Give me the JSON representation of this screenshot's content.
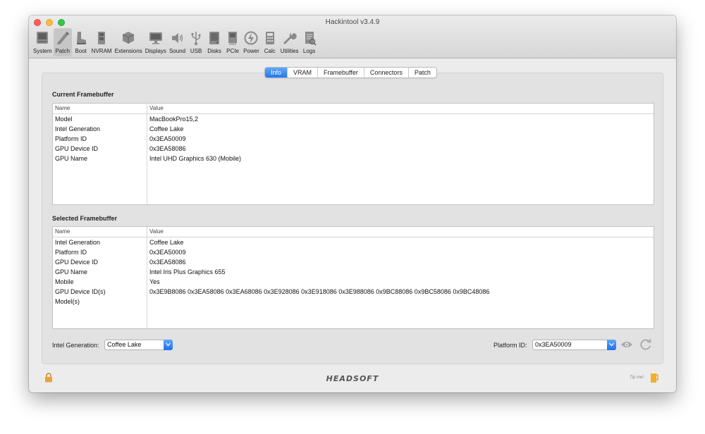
{
  "window": {
    "title": "Hackintool v3.4.9"
  },
  "toolbar": {
    "items": [
      {
        "label": "System",
        "icon": "system-icon"
      },
      {
        "label": "Patch",
        "icon": "patch-icon",
        "active": true
      },
      {
        "label": "Boot",
        "icon": "boot-icon"
      },
      {
        "label": "NVRAM",
        "icon": "nvram-icon"
      },
      {
        "label": "Extensions",
        "icon": "extensions-icon"
      },
      {
        "label": "Displays",
        "icon": "displays-icon"
      },
      {
        "label": "Sound",
        "icon": "sound-icon"
      },
      {
        "label": "USB",
        "icon": "usb-icon"
      },
      {
        "label": "Disks",
        "icon": "disks-icon"
      },
      {
        "label": "PCIe",
        "icon": "pcie-icon"
      },
      {
        "label": "Power",
        "icon": "power-icon"
      },
      {
        "label": "Calc",
        "icon": "calc-icon"
      },
      {
        "label": "Utilities",
        "icon": "utilities-icon"
      },
      {
        "label": "Logs",
        "icon": "logs-icon"
      }
    ]
  },
  "tabs": [
    {
      "label": "Info",
      "active": true
    },
    {
      "label": "VRAM"
    },
    {
      "label": "Framebuffer"
    },
    {
      "label": "Connectors"
    },
    {
      "label": "Patch"
    }
  ],
  "current_framebuffer": {
    "title": "Current Framebuffer",
    "columns": [
      "Name",
      "Value"
    ],
    "rows": [
      [
        "Model",
        "MacBookPro15,2"
      ],
      [
        "Intel Generation",
        "Coffee Lake"
      ],
      [
        "Platform ID",
        "0x3EA50009"
      ],
      [
        "GPU Device ID",
        "0x3EA58086"
      ],
      [
        "GPU Name",
        "Intel UHD Graphics 630 (Mobile)"
      ]
    ]
  },
  "selected_framebuffer": {
    "title": "Selected Framebuffer",
    "columns": [
      "Name",
      "Value"
    ],
    "rows": [
      [
        "Intel Generation",
        "Coffee Lake"
      ],
      [
        "Platform ID",
        "0x3EA50009"
      ],
      [
        "GPU Device ID",
        "0x3EA58086"
      ],
      [
        "GPU Name",
        "Intel Iris Plus Graphics 655"
      ],
      [
        "Mobile",
        "Yes"
      ],
      [
        "GPU Device ID(s)",
        "0x3E9B8086 0x3EA58086 0x3EA68086 0x3E928086 0x3E918086 0x3E988086 0x9BC88086 0x9BC58086 0x9BC48086"
      ],
      [
        "Model(s)",
        ""
      ]
    ]
  },
  "controls": {
    "intel_generation_label": "Intel Generation:",
    "intel_generation_value": "Coffee Lake",
    "platform_id_label": "Platform ID:",
    "platform_id_value": "0x3EA50009"
  },
  "footer": {
    "logo": "HEADSOFT",
    "tip_label": "Tip me!"
  },
  "colors": {
    "accent": "#2476f0",
    "window_bg": "#ececec",
    "content_bg": "#e2e2e2"
  }
}
